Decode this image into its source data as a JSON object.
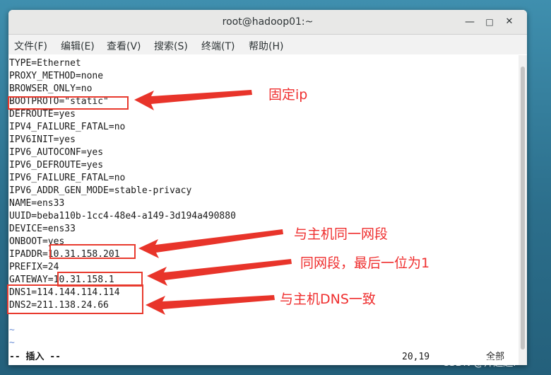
{
  "window": {
    "title": "root@hadoop01:~",
    "controls": {
      "minimize": "—",
      "maximize": "□",
      "close": "✕"
    }
  },
  "menu": [
    {
      "label": "文件(F)"
    },
    {
      "label": "编辑(E)"
    },
    {
      "label": "查看(V)"
    },
    {
      "label": "搜索(S)"
    },
    {
      "label": "终端(T)"
    },
    {
      "label": "帮助(H)"
    }
  ],
  "terminal": {
    "lines": [
      "TYPE=Ethernet",
      "PROXY_METHOD=none",
      "BROWSER_ONLY=no",
      "BOOTPROTO=\"static\"",
      "DEFROUTE=yes",
      "IPV4_FAILURE_FATAL=no",
      "IPV6INIT=yes",
      "IPV6_AUTOCONF=yes",
      "IPV6_DEFROUTE=yes",
      "IPV6_FAILURE_FATAL=no",
      "IPV6_ADDR_GEN_MODE=stable-privacy",
      "NAME=ens33",
      "UUID=beba110b-1cc4-48e4-a149-3d194a490880",
      "DEVICE=ens33",
      "ONBOOT=yes",
      "IPADDR=10.31.158.201",
      "PREFIX=24",
      "GATEWAY=10.31.158.1",
      "DNS1=114.144.114.114",
      "DNS2=211.138.24.66"
    ],
    "empty_markers": [
      "~",
      "~"
    ],
    "status_mode": "-- 插入 --",
    "cursor_position": "20,19",
    "scroll_position": "全部"
  },
  "annotations": [
    {
      "text": "固定ip",
      "color": "#ef2f2f"
    },
    {
      "text": "与主机同一网段",
      "color": "#ef2f2f"
    },
    {
      "text": "同网段，最后一位为1",
      "color": "#ef2f2f"
    },
    {
      "text": "与主机DNS一致",
      "color": "#ef2f2f"
    }
  ],
  "watermark": "CSDN @帅超超i"
}
